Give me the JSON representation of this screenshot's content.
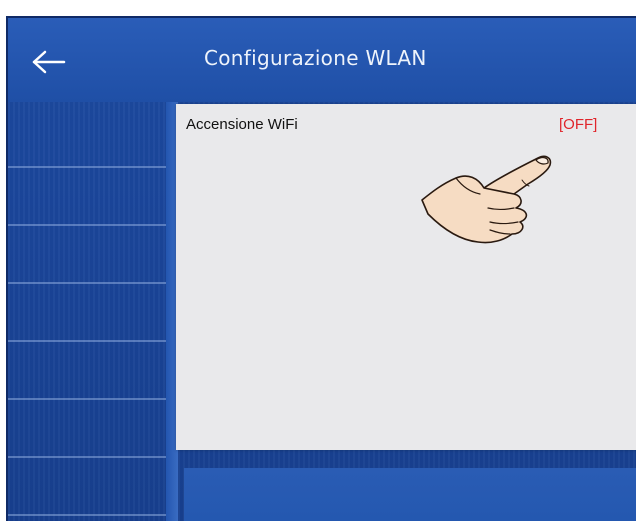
{
  "header": {
    "title": "Configurazione WLAN",
    "back_icon": "arrow-left-icon"
  },
  "settings": {
    "rows": [
      {
        "label": "Accensione WiFi",
        "value": "[OFF]"
      }
    ]
  },
  "overlay": {
    "pointer_icon": "pointing-hand-icon"
  },
  "colors": {
    "header_blue": "#1f4fa6",
    "screen_blue": "#1a459a",
    "panel_bg": "#e9e9eb",
    "status_off": "#e0252b",
    "title_text": "#eef3fb"
  }
}
